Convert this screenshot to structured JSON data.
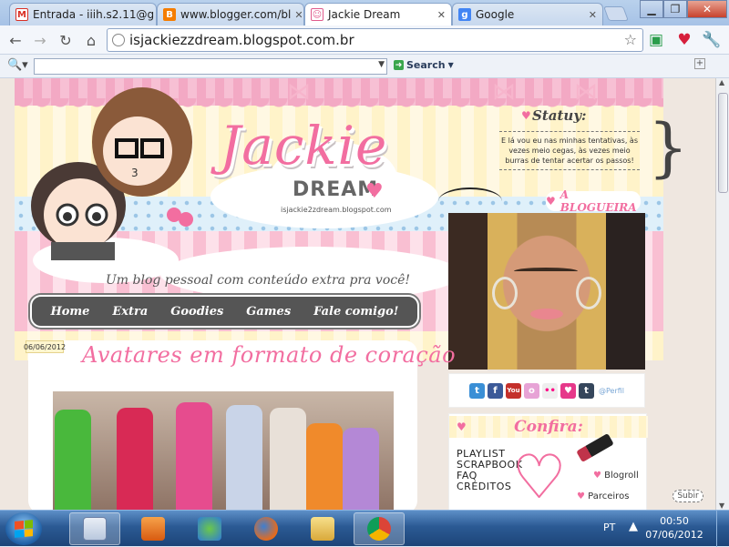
{
  "browser": {
    "tabs": [
      {
        "label": "Entrada - iiih.s2.11@g",
        "favicon": "gmail-icon"
      },
      {
        "label": "www.blogger.com/bl",
        "favicon": "blogger-icon"
      },
      {
        "label": "Jackie Dream",
        "favicon": "kitty-icon",
        "active": true
      },
      {
        "label": "Google",
        "favicon": "google-icon"
      }
    ],
    "url": "isjackiezzdream.blogspot.com.br",
    "search_button": "Search"
  },
  "colors": {
    "accent_pink": "#f26ea0",
    "menu_gray": "#555555",
    "taskbar_blue": "#2b5a94"
  },
  "header": {
    "logo_main": "Jackie",
    "logo_sub": "DREAM",
    "logo_url": "isjackie2zdream.blogspot.com",
    "status_title": "Statuy:",
    "status_text": "E lá vou eu nas minhas tentativas, às vezes meio cegas, às vezes meio burras de tentar acertar os passos!",
    "blogueira_label": "A BLOGUEIRA",
    "tagline": "Um blog pessoal com conteúdo extra pra você!"
  },
  "menu": [
    "Home",
    "Extra",
    "Goodies",
    "Games",
    "Fale comigo!"
  ],
  "post": {
    "date": "06/06/2012",
    "title": "Avatares em formato de coração"
  },
  "sidebar": {
    "social_icons": [
      "twitter-icon",
      "facebook-icon",
      "youtube-icon",
      "orkut-icon",
      "flickr-icon",
      "heart-icon",
      "tumblr-icon"
    ],
    "perfil_label": "@Perfil",
    "confira_title": "Confira:",
    "links": [
      "PLAYLIST",
      "SCRAPBOOK",
      "FAQ",
      "CRÉDITOS"
    ],
    "blogroll": "Blogroll",
    "parceiros": "Parceiros",
    "subir": "Subir"
  },
  "taskbar": {
    "language": "PT",
    "time": "00:50",
    "date": "07/06/2012"
  }
}
